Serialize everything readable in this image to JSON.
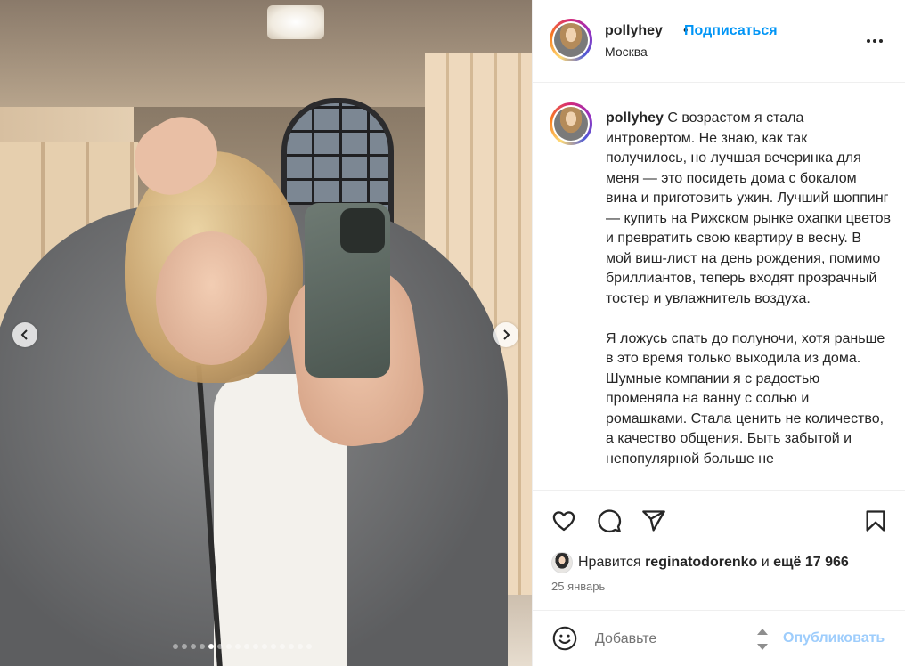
{
  "post": {
    "username": "pollyhey",
    "separator": "•",
    "follow_label": "Подписаться",
    "location": "Москва",
    "more_icon": "more-horizontal-icon"
  },
  "caption": {
    "username": "pollyhey",
    "paragraph_1": "С возрастом я стала интровертом. Не знаю, как так получилось, но лучшая вечеринка для меня — это посидеть дома с бокалом вина и приготовить ужин. Лучший шоппинг — купить на Рижском рынке охапки цветов и превратить свою квартиру в весну. В мой виш-лист на день рождения, помимо бриллиантов, теперь входят прозрачный тостер и увлажнитель воздуха.",
    "paragraph_2": "Я ложусь спать до полуночи, хотя раньше в это время только выходила из дома. Шумные компании я с радостью променяла на ванну с солью и ромашками. Стала ценить не количество, а качество общения. Быть забытой и непопулярной больше не"
  },
  "carousel": {
    "total_slides": 16,
    "current_slide": 5,
    "prev_icon": "chevron-left-icon",
    "next_icon": "chevron-right-icon"
  },
  "actions": {
    "like_icon": "heart-icon",
    "comment_icon": "comment-icon",
    "share_icon": "share-icon",
    "save_icon": "bookmark-icon"
  },
  "likes": {
    "prefix": "Нравится",
    "user": "reginatodorenko",
    "joiner": "и",
    "others": "ещё 17 966"
  },
  "date": "25 январь",
  "comment": {
    "placeholder": "Добавьте",
    "publish_label": "Опубликовать"
  },
  "colors": {
    "accent": "#0095f6",
    "publish_disabled": "#9ecdfc",
    "text": "#262626",
    "muted": "#737373",
    "divider": "#efefef"
  }
}
